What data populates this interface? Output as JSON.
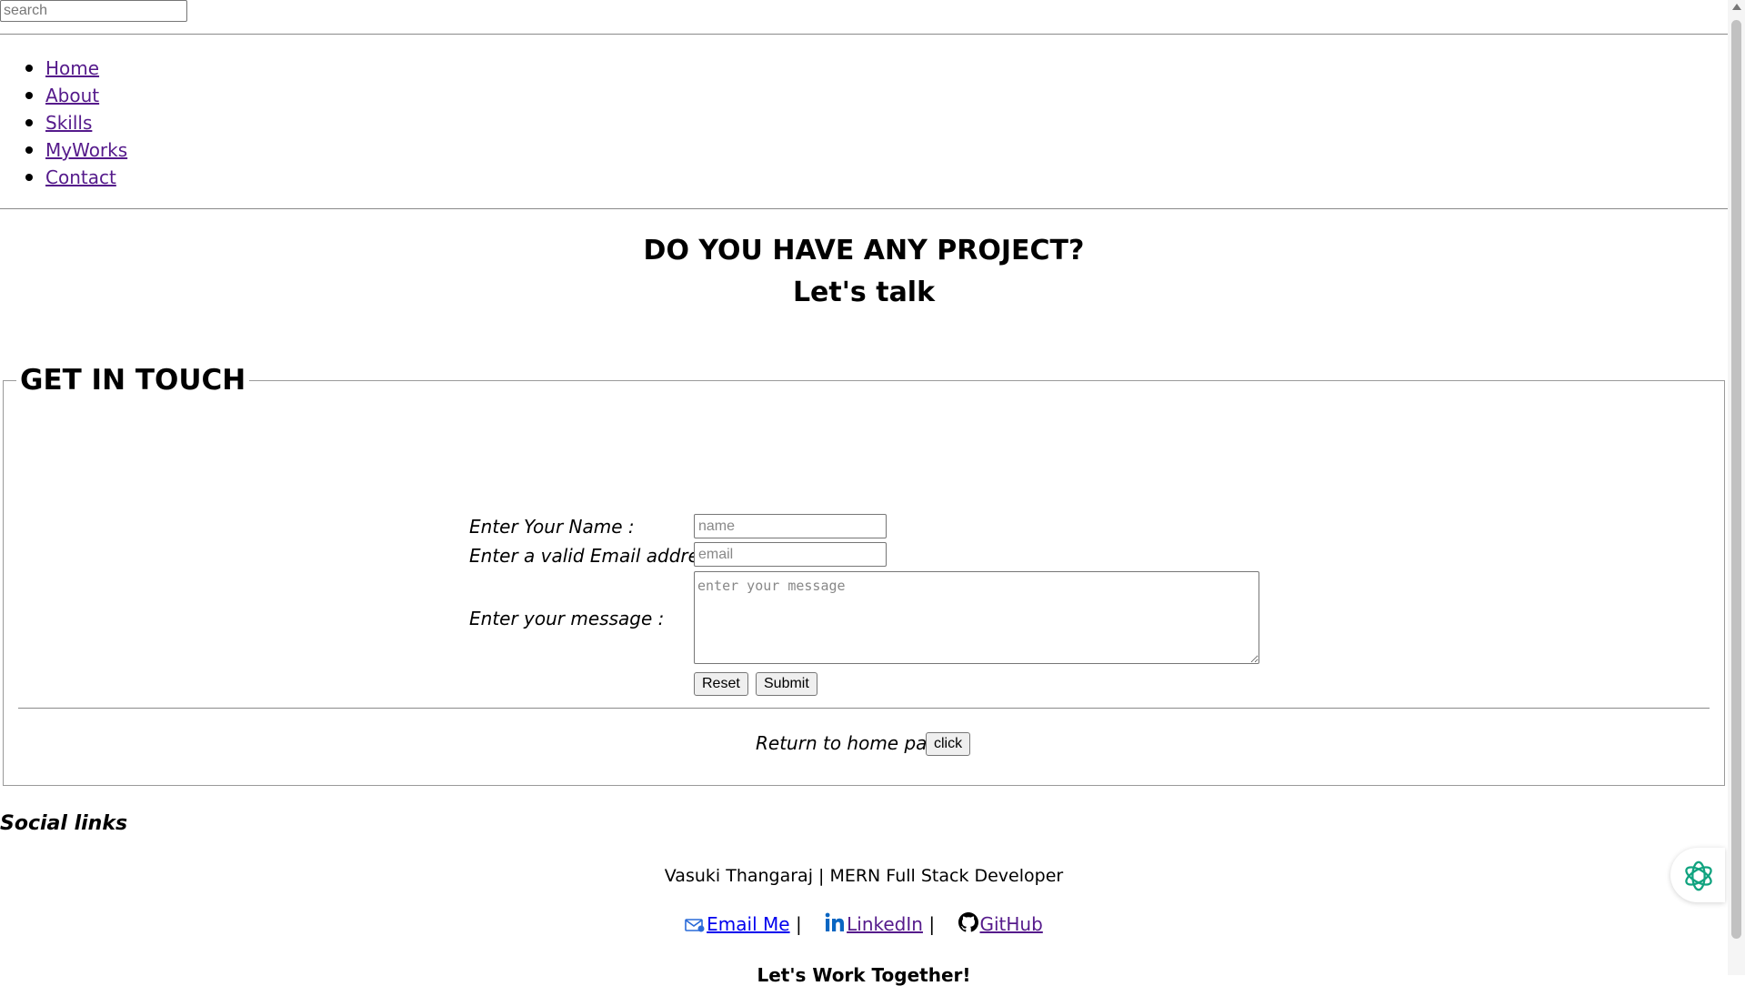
{
  "search": {
    "placeholder": "search"
  },
  "nav": {
    "items": [
      "Home",
      "About",
      "Skills",
      "MyWorks",
      "Contact"
    ]
  },
  "hero": {
    "title": "DO YOU HAVE ANY PROJECT?",
    "subtitle": "Let's talk"
  },
  "contact": {
    "legend": "GET IN TOUCH",
    "name_label": "Enter Your Name :",
    "name_placeholder": "name",
    "email_label": "Enter a valid Email address :",
    "email_placeholder": "email",
    "message_label": "Enter your message :",
    "message_placeholder": "enter your message",
    "reset_label": "Reset",
    "submit_label": "Submit",
    "return_text": "Return to home page",
    "return_button": "click"
  },
  "footer": {
    "social_heading": "Social links",
    "credit": "Vasuki Thangaraj | MERN Full Stack Developer",
    "links": [
      "Email Me",
      "LinkedIn",
      "GitHub"
    ],
    "separator": "|",
    "bottom_text": "Let's Work Together!"
  },
  "colors": {
    "link": "#0000ee",
    "visited": "#551a8b",
    "linkedin": "#0a66c2",
    "chat_icon": "#10a37f"
  }
}
